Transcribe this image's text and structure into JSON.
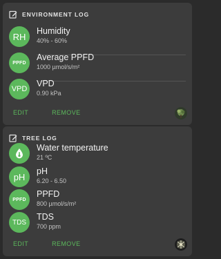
{
  "colors": {
    "accent": "#5cb85c",
    "card": "#3c3c3c",
    "background": "#2b2b2b"
  },
  "environment_log": {
    "title": "ENVIRONMENT LOG",
    "icon": "edit-note-icon",
    "rows": [
      {
        "badge": "RH",
        "label": "Humidity",
        "value": "40% - 60%"
      },
      {
        "badge": "PPFD",
        "label": "Average PPFD",
        "value": "1000 µmol/s/m²"
      },
      {
        "badge": "VPD",
        "label": "VPD",
        "value": "0.90 kPa"
      }
    ],
    "actions": {
      "edit": "EDIT",
      "remove": "REMOVE"
    },
    "avatar_icon": "plant-avatar-icon"
  },
  "tree_log": {
    "title": "TREE LOG",
    "icon": "edit-note-icon",
    "rows": [
      {
        "badge_icon": "water-drop-thermometer-icon",
        "label": "Water temperature",
        "value": "21 ºC"
      },
      {
        "badge": "pH",
        "label": "pH",
        "value": "6.20 - 6.50"
      },
      {
        "badge": "PPFD",
        "label": "PPFD",
        "value": "800 µmol/s/m²"
      },
      {
        "badge": "TDS",
        "label": "TDS",
        "value": "700 ppm"
      }
    ],
    "actions": {
      "edit": "EDIT",
      "remove": "REMOVE"
    },
    "avatar_icon": "plant-avatar-icon"
  }
}
